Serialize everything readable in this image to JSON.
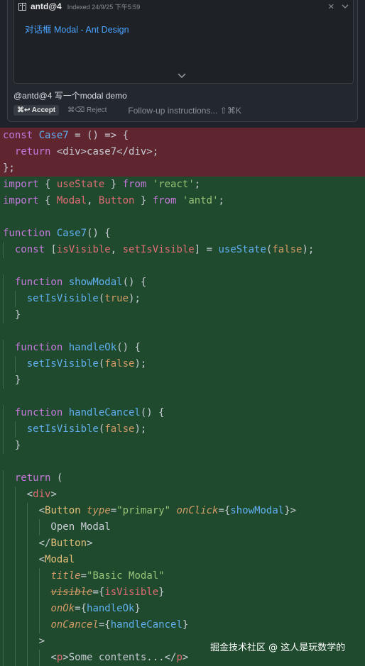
{
  "doc": {
    "title": "antd@4",
    "indexed": "Indexed 24/9/25 下午5:59",
    "link": "对话框 Modal - Ant Design"
  },
  "query": "@antd@4 写一个modal demo",
  "actions": {
    "accept": "⌘↩ Accept",
    "reject": "⌘⌫ Reject",
    "followup": "Follow-up instructions... ⇧⌘K"
  },
  "watermark": "掘金技术社区 @ 这人是玩数学的",
  "colors": {
    "deleted_bg": "#5f2630",
    "added_bg": "#1f4a2e",
    "link": "#4aa3ff"
  },
  "code": {
    "deleted": [
      [
        [
          "kw",
          "const "
        ],
        [
          "fn",
          "Case7"
        ],
        [
          "pl",
          " = () => {"
        ]
      ],
      [
        [
          "pl",
          "  "
        ],
        [
          "kw",
          "return "
        ],
        [
          "pl",
          "<div>case7</div>;"
        ]
      ],
      [
        [
          "pl",
          "};"
        ]
      ]
    ],
    "added": [
      [
        [
          "kw",
          "import"
        ],
        [
          "pl",
          " { "
        ],
        [
          "var",
          "useState"
        ],
        [
          "pl",
          " } "
        ],
        [
          "kw",
          "from"
        ],
        [
          "pl",
          " "
        ],
        [
          "str",
          "'react'"
        ],
        [
          "pl",
          ";"
        ]
      ],
      [
        [
          "kw",
          "import"
        ],
        [
          "pl",
          " { "
        ],
        [
          "var",
          "Modal"
        ],
        [
          "pl",
          ", "
        ],
        [
          "var",
          "Button"
        ],
        [
          "pl",
          " } "
        ],
        [
          "kw",
          "from"
        ],
        [
          "pl",
          " "
        ],
        [
          "str",
          "'antd'"
        ],
        [
          "pl",
          ";"
        ]
      ],
      [],
      [
        [
          "kw",
          "function "
        ],
        [
          "fn",
          "Case7"
        ],
        [
          "pl",
          "() {"
        ]
      ],
      [
        [
          "pl",
          "  "
        ],
        [
          "kw",
          "const"
        ],
        [
          "pl",
          " ["
        ],
        [
          "var",
          "isVisible"
        ],
        [
          "pl",
          ", "
        ],
        [
          "var",
          "setIsVisible"
        ],
        [
          "pl",
          "] = "
        ],
        [
          "fn",
          "useState"
        ],
        [
          "pl",
          "("
        ],
        [
          "num",
          "false"
        ],
        [
          "pl",
          ");"
        ]
      ],
      [],
      [
        [
          "pl",
          "  "
        ],
        [
          "kw",
          "function "
        ],
        [
          "fn",
          "showModal"
        ],
        [
          "pl",
          "() {"
        ]
      ],
      [
        [
          "pl",
          "    "
        ],
        [
          "fn",
          "setIsVisible"
        ],
        [
          "pl",
          "("
        ],
        [
          "num",
          "true"
        ],
        [
          "pl",
          ");"
        ]
      ],
      [
        [
          "pl",
          "  }"
        ]
      ],
      [],
      [
        [
          "pl",
          "  "
        ],
        [
          "kw",
          "function "
        ],
        [
          "fn",
          "handleOk"
        ],
        [
          "pl",
          "() {"
        ]
      ],
      [
        [
          "pl",
          "    "
        ],
        [
          "fn",
          "setIsVisible"
        ],
        [
          "pl",
          "("
        ],
        [
          "num",
          "false"
        ],
        [
          "pl",
          ");"
        ]
      ],
      [
        [
          "pl",
          "  }"
        ]
      ],
      [],
      [
        [
          "pl",
          "  "
        ],
        [
          "kw",
          "function "
        ],
        [
          "fn",
          "handleCancel"
        ],
        [
          "pl",
          "() {"
        ]
      ],
      [
        [
          "pl",
          "    "
        ],
        [
          "fn",
          "setIsVisible"
        ],
        [
          "pl",
          "("
        ],
        [
          "num",
          "false"
        ],
        [
          "pl",
          ");"
        ]
      ],
      [
        [
          "pl",
          "  }"
        ]
      ],
      [],
      [
        [
          "pl",
          "  "
        ],
        [
          "kw",
          "return"
        ],
        [
          "pl",
          " ("
        ]
      ],
      [
        [
          "pl",
          "    <"
        ],
        [
          "tag",
          "div"
        ],
        [
          "pl",
          ">"
        ]
      ],
      [
        [
          "pl",
          "      <"
        ],
        [
          "comp",
          "Button"
        ],
        [
          "pl",
          " "
        ],
        [
          "attr",
          "type"
        ],
        [
          "pl",
          "="
        ],
        [
          "str",
          "\"primary\""
        ],
        [
          "pl",
          " "
        ],
        [
          "attr",
          "onClick"
        ],
        [
          "pl",
          "={"
        ],
        [
          "fn",
          "showModal"
        ],
        [
          "pl",
          "}>"
        ]
      ],
      [
        [
          "pl",
          "        Open Modal"
        ]
      ],
      [
        [
          "pl",
          "      </"
        ],
        [
          "comp",
          "Button"
        ],
        [
          "pl",
          ">"
        ]
      ],
      [
        [
          "pl",
          "      <"
        ],
        [
          "comp",
          "Modal"
        ]
      ],
      [
        [
          "pl",
          "        "
        ],
        [
          "attr",
          "title"
        ],
        [
          "pl",
          "="
        ],
        [
          "str",
          "\"Basic Modal\""
        ]
      ],
      [
        [
          "pl",
          "        "
        ],
        [
          "attrs",
          "visible"
        ],
        [
          "pl",
          "={"
        ],
        [
          "var",
          "isVisible"
        ],
        [
          "pl",
          "}"
        ]
      ],
      [
        [
          "pl",
          "        "
        ],
        [
          "attr",
          "onOk"
        ],
        [
          "pl",
          "={"
        ],
        [
          "fn",
          "handleOk"
        ],
        [
          "pl",
          "}"
        ]
      ],
      [
        [
          "pl",
          "        "
        ],
        [
          "attr",
          "onCancel"
        ],
        [
          "pl",
          "={"
        ],
        [
          "fn",
          "handleCancel"
        ],
        [
          "pl",
          "}"
        ]
      ],
      [
        [
          "pl",
          "      >"
        ]
      ],
      [
        [
          "pl",
          "        <"
        ],
        [
          "tag",
          "p"
        ],
        [
          "pl",
          ">Some contents...</"
        ],
        [
          "tag",
          "p"
        ],
        [
          "pl",
          ">"
        ]
      ]
    ]
  }
}
